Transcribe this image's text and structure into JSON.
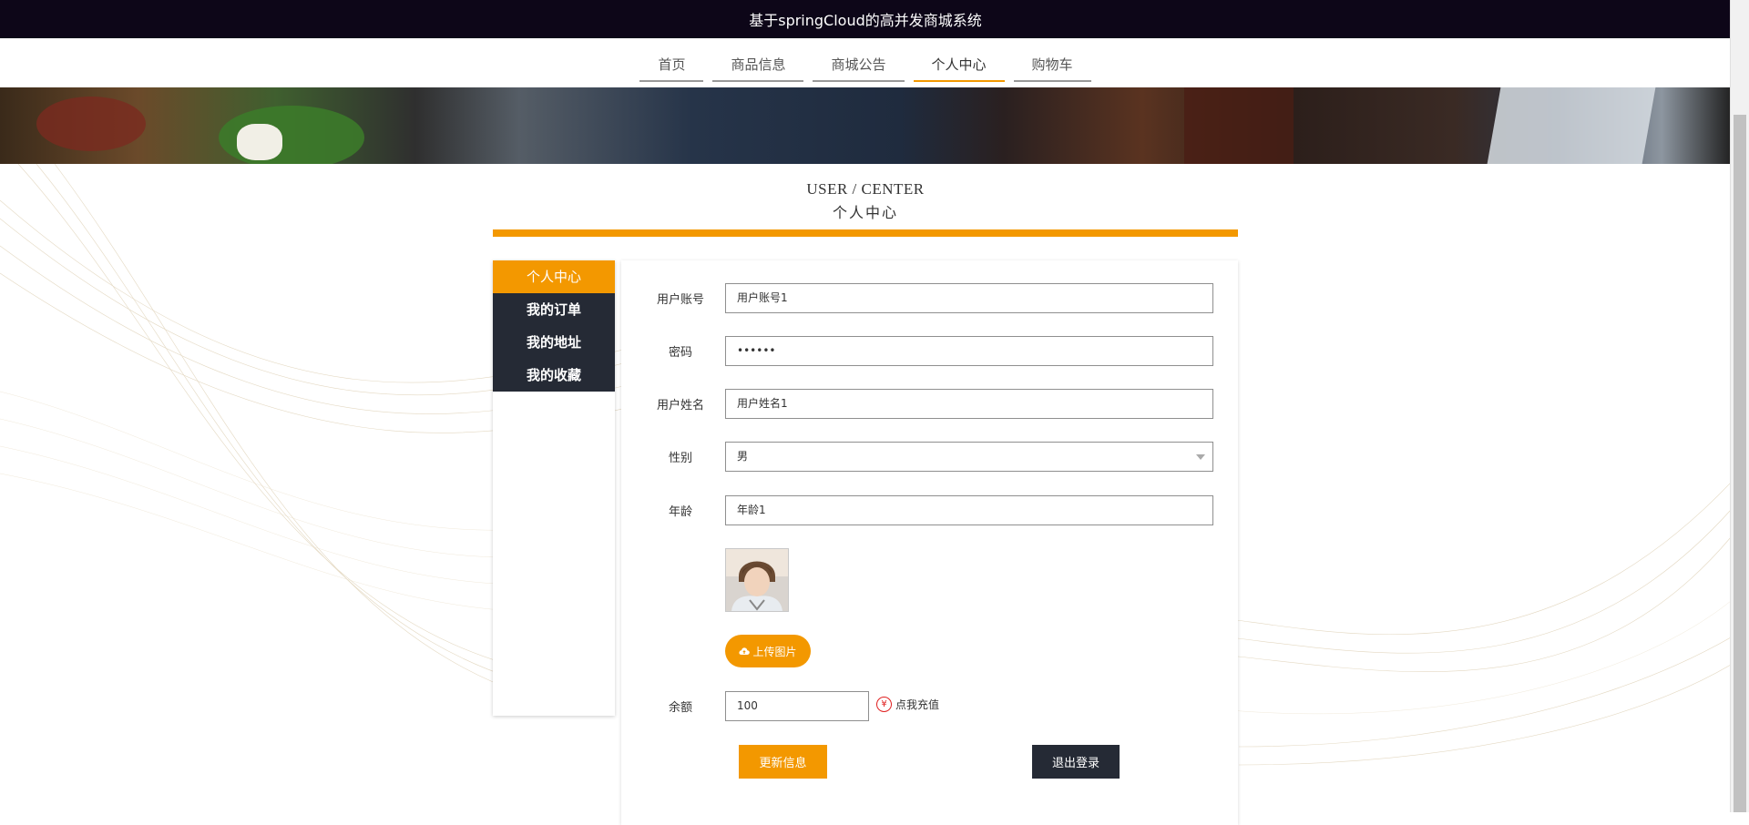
{
  "app": {
    "title": "基于springCloud的高并发商城系统"
  },
  "nav": {
    "items": [
      {
        "label": "首页",
        "active": false
      },
      {
        "label": "商品信息",
        "active": false
      },
      {
        "label": "商城公告",
        "active": false
      },
      {
        "label": "个人中心",
        "active": true
      },
      {
        "label": "购物车",
        "active": false
      }
    ]
  },
  "heading": {
    "en": "USER / CENTER",
    "cn": "个人中心"
  },
  "sidebar": {
    "items": [
      {
        "label": "个人中心",
        "active": true
      },
      {
        "label": "我的订单",
        "active": false
      },
      {
        "label": "我的地址",
        "active": false
      },
      {
        "label": "我的收藏",
        "active": false
      }
    ]
  },
  "form": {
    "account": {
      "label": "用户账号",
      "value": "用户账号1"
    },
    "password": {
      "label": "密码",
      "value": "••••••"
    },
    "name": {
      "label": "用户姓名",
      "value": "用户姓名1"
    },
    "gender": {
      "label": "性别",
      "value": "男"
    },
    "age": {
      "label": "年龄",
      "value": "年龄1"
    },
    "upload_label": "上传图片",
    "balance": {
      "label": "余额",
      "value": "100"
    },
    "recharge_label": "点我充值",
    "recharge_icon": "¥",
    "update_button": "更新信息",
    "logout_button": "退出登录"
  },
  "colors": {
    "accent": "#f39800",
    "dark": "#252a35",
    "topbar": "#0d0618"
  }
}
